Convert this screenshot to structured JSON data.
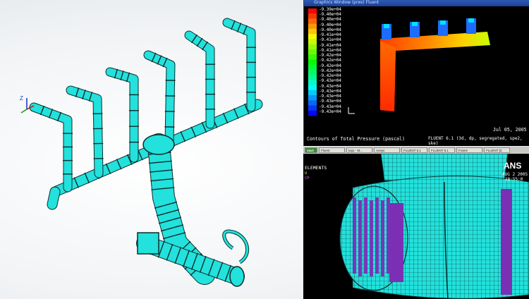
{
  "colors": {
    "mesh_cyan": "#23e1dc",
    "mesh_line": "#0a2e2e",
    "flange_purple": "#7a2fb5",
    "fluent_bg": "#000000",
    "ansys_bg": "#000000"
  },
  "fluent": {
    "window_title": "Graphics Window (pres) Fluent",
    "legend_values": [
      "-9.39e+04",
      "-9.40e+04",
      "-9.40e+04",
      "-9.40e+04",
      "-9.40e+04",
      "-9.41e+04",
      "-9.41e+04",
      "-9.41e+04",
      "-9.41e+04",
      "-9.42e+04",
      "-9.42e+04",
      "-9.42e+04",
      "-9.42e+04",
      "-9.42e+04",
      "-9.43e+04",
      "-9.43e+04",
      "-9.43e+04",
      "-9.43e+04",
      "-9.43e+04",
      "-9.43e+04",
      "-9.43e+04"
    ],
    "caption": "Contours of Total Pressure (pascal)",
    "date": "Jul 05, 2005",
    "solver_info": "FLUENT 6.1 (3d, dp, segregated, spe2, ske)"
  },
  "taskbar": {
    "items": [
      "start",
      "Fluent",
      "log1 - M...",
      "Ansys",
      "FLUENT 6.1",
      "FLUENT 6.1",
      "Frame",
      "FLUENT [C"
    ]
  },
  "ansys": {
    "elements_label": "ELEMENTS",
    "legend_line1": "U",
    "legend_line2": "CP",
    "brand": "ANS",
    "date": "AUG 2 2005",
    "time": "18:55:0"
  },
  "triad": {
    "label": "Z"
  }
}
